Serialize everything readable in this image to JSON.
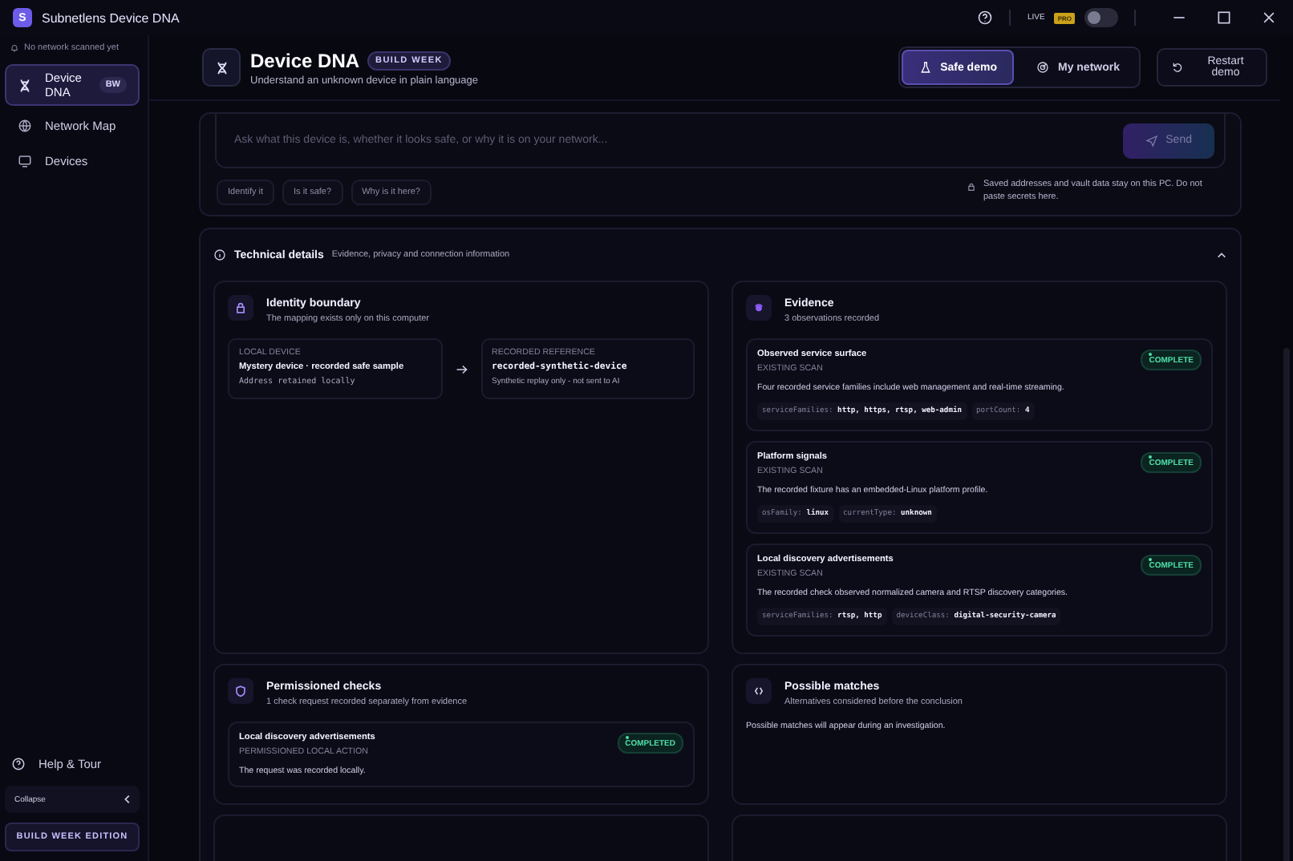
{
  "window": {
    "logo": "S",
    "title": "Subnetlens Device DNA",
    "live_label": "LIVE",
    "pro_badge": "PRO",
    "live_on": false
  },
  "sidebar": {
    "status": "No network scanned yet",
    "items": [
      {
        "label": "Device DNA",
        "badge": "BW",
        "kind": "dna",
        "selected": true
      },
      {
        "label": "Network Map",
        "kind": "globe",
        "selected": false
      },
      {
        "label": "Devices",
        "kind": "monitor",
        "selected": false
      }
    ],
    "help": "Help & Tour",
    "collapse": "Collapse",
    "edition": "BUILD WEEK EDITION"
  },
  "header": {
    "title": "Device DNA",
    "badge": "BUILD WEEK",
    "subtitle": "Understand an unknown device in plain language",
    "modes": [
      {
        "label": "Safe demo",
        "kind": "flask",
        "selected": true
      },
      {
        "label": "My network",
        "kind": "radar",
        "selected": false
      }
    ],
    "restart": "Restart demo"
  },
  "ask": {
    "placeholder": "Ask what this device is, whether it looks safe, or why it is on your network...",
    "send": "Send",
    "send_disabled": true,
    "suggestions": [
      "Identify it",
      "Is it safe?",
      "Why is it here?"
    ],
    "privacy_note": "Saved addresses and vault data stay on this PC. Do not paste secrets here."
  },
  "technical": {
    "title": "Technical details",
    "subtitle": "Evidence, privacy and connection information",
    "expanded": true,
    "identity": {
      "title": "Identity boundary",
      "subtitle": "The mapping exists only on this computer",
      "local": {
        "label": "LOCAL DEVICE",
        "name": "Mystery device · recorded safe sample",
        "note": "Address retained locally"
      },
      "reference": {
        "label": "RECORDED REFERENCE",
        "name": "recorded-synthetic-device",
        "note": "Synthetic replay only - not sent to AI"
      }
    },
    "evidence": {
      "title": "Evidence",
      "subtitle": "3 observations recorded",
      "items": [
        {
          "title": "Observed service surface",
          "source": "EXISTING SCAN",
          "status": "COMPLETE",
          "description": "Four recorded service families include web management and real-time streaming.",
          "facts": [
            {
              "key": "serviceFamilies:",
              "value": "http, https, rtsp, web-admin"
            },
            {
              "key": "portCount:",
              "value": "4"
            }
          ]
        },
        {
          "title": "Platform signals",
          "source": "EXISTING SCAN",
          "status": "COMPLETE",
          "description": "The recorded fixture has an embedded-Linux platform profile.",
          "facts": [
            {
              "key": "osFamily:",
              "value": "linux"
            },
            {
              "key": "currentType:",
              "value": "unknown"
            }
          ]
        },
        {
          "title": "Local discovery advertisements",
          "source": "EXISTING SCAN",
          "status": "COMPLETE",
          "description": "The recorded check observed normalized camera and RTSP discovery categories.",
          "facts": [
            {
              "key": "serviceFamilies:",
              "value": "rtsp, http"
            },
            {
              "key": "deviceClass:",
              "value": "digital-security-camera"
            }
          ]
        }
      ]
    },
    "checks": {
      "title": "Permissioned checks",
      "subtitle": "1 check request recorded separately from evidence",
      "items": [
        {
          "title": "Local discovery advertisements",
          "source": "PERMISSIONED LOCAL ACTION",
          "status": "COMPLETED",
          "description": "The request was recorded locally."
        }
      ]
    },
    "matches": {
      "title": "Possible matches",
      "subtitle": "Alternatives considered before the conclusion",
      "empty": "Possible matches will appear during an investigation."
    }
  }
}
